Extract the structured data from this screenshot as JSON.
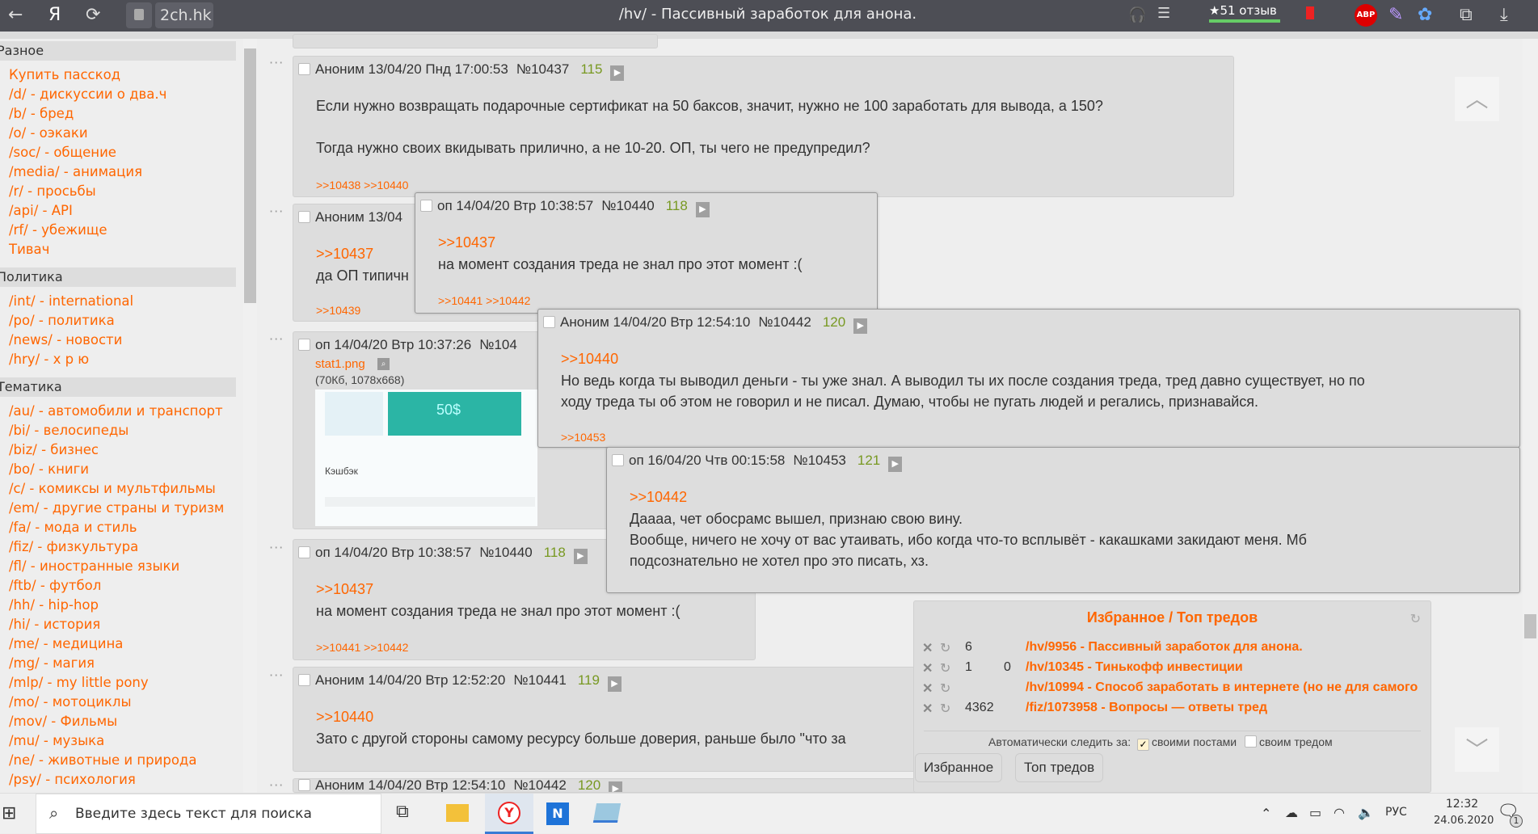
{
  "browser": {
    "back_icon": "←",
    "yandex_icon": "Я",
    "reload_icon": "⟳",
    "host": "2ch.hk",
    "title": "/hv/ - Пассивный заработок для анона.",
    "reviews": "★51 отзыв",
    "adblock": "ABP"
  },
  "sidebar": {
    "categories": [
      {
        "title": "Разное",
        "items": [
          "Купить пасскод",
          "/d/  - дискуссии о два.ч",
          "/b/  - бред",
          "/o/  - оэкаки",
          "/soc/  - общение",
          "/media/  - анимация",
          "/r/  - просьбы",
          "/api/  - API",
          "/rf/  - убежище",
          "Тивач"
        ]
      },
      {
        "title": "Политика",
        "items": [
          "/int/  - international",
          "/po/  - политика",
          "/news/  - новости",
          "/hry/  - х р ю"
        ]
      },
      {
        "title": "Тематика",
        "items": [
          "/au/  - автомобили и транспорт",
          "/bi/  - велосипеды",
          "/biz/  - бизнес",
          "/bo/  - книги",
          "/c/  - комиксы и мультфильмы",
          "/em/  - другие страны и туризм",
          "/fa/  - мода и стиль",
          "/fiz/  - физкультура",
          "/fl/  - иностранные языки",
          "/ftb/  - футбол",
          "/hh/  - hip-hop",
          "/hi/  - история",
          "/me/  - медицина",
          "/mg/  - магия",
          "/mlp/  - my little pony",
          "/mo/  - мотоциклы",
          "/mov/  - Фильмы",
          "/mu/  - музыка",
          "/ne/  - животные и природа",
          "/psy/  - психология"
        ]
      }
    ]
  },
  "posts": {
    "p10437": {
      "author": "Аноним",
      "date": "13/04/20 Пнд 17:00:53",
      "num": "№10437",
      "count": "115",
      "line1": "Если нужно возвращать подарочные сертификат на 50 баксов, значит, нужно не 100 заработать для вывода, а 150?",
      "line2": "Тогда нужно своих вкидывать прилично, а не 10-20. ОП, ты чего не предупредил?",
      "replies": ">>10438 >>10440"
    },
    "p10438": {
      "author": "Аноним",
      "date": "13/04",
      "ref": ">>10437",
      "body": "да ОП типичн",
      "replies": ">>10439"
    },
    "p10439": {
      "author": "оп",
      "date": "14/04/20 Втр 10:37:26",
      "num": "№104",
      "file": "stat1.png",
      "fileinfo": "(70Кб, 1078x668)",
      "thumb_heading": "Кэшбэк",
      "thumb_amount": "50$"
    },
    "p10440": {
      "author": "оп",
      "date": "14/04/20 Втр 10:38:57",
      "num": "№10440",
      "count": "118",
      "ref": ">>10437",
      "body": "на момент создания треда не знал про этот момент :(",
      "replies": ">>10441 >>10442"
    },
    "p10441": {
      "author": "Аноним",
      "date": "14/04/20 Втр 12:52:20",
      "num": "№10441",
      "count": "119",
      "ref": ">>10440",
      "body": "Зато с другой стороны самому ресурсу больше доверия, раньше было \"что за"
    },
    "p10442": {
      "author": "Аноним",
      "date": "14/04/20 Втр 12:54:10",
      "num": "№10442",
      "count": "120",
      "ref": ">>10440",
      "line1": "Но ведь когда ты выводил деньги - ты уже знал. А выводил ты их после создания треда, тред давно существует, но по",
      "line2": "ходу треда ты об этом не говорил и не писал. Думаю, чтобы не пугать людей и регались, признавайся.",
      "replies": ">>10453"
    },
    "p10453": {
      "author": "оп",
      "date": "16/04/20 Чтв 00:15:58",
      "num": "№10453",
      "count": "121",
      "ref": ">>10442",
      "line1": "Даааа, чет обосрамс вышел, признаю свою вину.",
      "line2": "Вообще, ничего не хочу от вас утаивать, ибо когда что-то всплывёт - какашками закидают меня. Мб",
      "line3": "подсознательно не хотел про это писать, хз."
    }
  },
  "favorites": {
    "title": "Избранное / Топ тредов",
    "rows": [
      {
        "n1": "6",
        "n2": "",
        "link": "/hv/9956 - Пассивный заработок для анона."
      },
      {
        "n1": "1",
        "n2": "0",
        "link": "/hv/10345 - Тинькофф инвестиции"
      },
      {
        "n1": "",
        "n2": "",
        "link": "/hv/10994 - Способ заработать в интернете (но не для самого"
      },
      {
        "n1": "4362",
        "n2": "",
        "link": "/fiz/1073958 - Вопросы — ответы тред"
      }
    ],
    "auto_label": "Автоматически следить за:",
    "opt1": "своими постами",
    "opt1_checked": true,
    "opt2": "своим тредом",
    "opt2_checked": false,
    "tab1": "Избранное",
    "tab2": "Топ тредов"
  },
  "taskbar": {
    "search_placeholder": "Введите здесь текст для поиска",
    "lang": "РУС",
    "time": "12:32",
    "date": "24.06.2020",
    "notif": "1"
  },
  "colors": {
    "link": "#ff6600",
    "count": "#789922",
    "post_bg": "#dddddd"
  }
}
